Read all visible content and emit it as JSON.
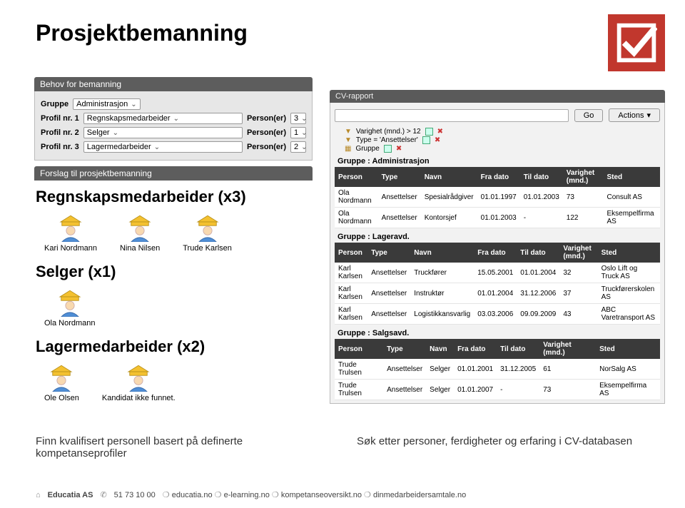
{
  "page_title": "Prosjektbemanning",
  "panel_need": {
    "title": "Behov for bemanning",
    "group_label": "Gruppe",
    "group_value": "Administrasjon",
    "rows": [
      {
        "label": "Profil nr. 1",
        "value": "Regnskapsmedarbeider",
        "persons_label": "Person(er)",
        "count": "3"
      },
      {
        "label": "Profil nr. 2",
        "value": "Selger",
        "persons_label": "Person(er)",
        "count": "1"
      },
      {
        "label": "Profil nr. 3",
        "value": "Lagermedarbeider",
        "persons_label": "Person(er)",
        "count": "2"
      }
    ]
  },
  "panel_suggest": "Forslag til prosjektbemanning",
  "sections": [
    {
      "title": "Regnskapsmedarbeider (x3)",
      "people": [
        {
          "name": "Kari Nordmann"
        },
        {
          "name": "Nina Nilsen"
        },
        {
          "name": "Trude Karlsen"
        }
      ]
    },
    {
      "title": "Selger (x1)",
      "people": [
        {
          "name": "Ola Nordmann"
        }
      ]
    },
    {
      "title": "Lagermedarbeider (x2)",
      "people": [
        {
          "name": "Ole Olsen"
        },
        {
          "name": "Kandidat ikke funnet."
        }
      ]
    }
  ],
  "cv": {
    "title": "CV-rapport",
    "go": "Go",
    "actions": "Actions",
    "filters": [
      {
        "label": "Varighet (mnd.) > 12"
      },
      {
        "label": "Type = 'Ansettelser'"
      },
      {
        "label": "Gruppe"
      }
    ],
    "headers": [
      "Person",
      "Type",
      "Navn",
      "Fra dato",
      "Til dato",
      "Varighet (mnd.)",
      "Sted"
    ],
    "groups": [
      {
        "name": "Gruppe : Administrasjon",
        "rows": [
          [
            "Ola Nordmann",
            "Ansettelser",
            "Spesialrådgiver",
            "01.01.1997",
            "01.01.2003",
            "73",
            "Consult AS"
          ],
          [
            "Ola Nordmann",
            "Ansettelser",
            "Kontorsjef",
            "01.01.2003",
            "-",
            "122",
            "Eksempelfirma AS"
          ]
        ]
      },
      {
        "name": "Gruppe : Lageravd.",
        "rows": [
          [
            "Karl Karlsen",
            "Ansettelser",
            "Truckfører",
            "15.05.2001",
            "01.01.2004",
            "32",
            "Oslo Lift og Truck AS"
          ],
          [
            "Karl Karlsen",
            "Ansettelser",
            "Instruktør",
            "01.01.2004",
            "31.12.2006",
            "37",
            "Truckførerskolen AS"
          ],
          [
            "Karl Karlsen",
            "Ansettelser",
            "Logistikkansvarlig",
            "03.03.2006",
            "09.09.2009",
            "43",
            "ABC Varetransport AS"
          ]
        ]
      },
      {
        "name": "Gruppe : Salgsavd.",
        "rows": [
          [
            "Trude Trulsen",
            "Ansettelser",
            "Selger",
            "01.01.2001",
            "31.12.2005",
            "61",
            "NorSalg AS"
          ],
          [
            "Trude Trulsen",
            "Ansettelser",
            "Selger",
            "01.01.2007",
            "-",
            "73",
            "Eksempelfirma AS"
          ]
        ]
      }
    ]
  },
  "captions": {
    "left": "Finn kvalifisert personell basert på definerte kompetanseprofiler",
    "right": "Søk etter personer, ferdigheter og erfaring i CV-databasen"
  },
  "footer": {
    "company": "Educatia AS",
    "phone": "51 73 10 00",
    "links": [
      "educatia.no",
      "e-learning.no",
      "kompetanseoversikt.no",
      "dinmedarbeidersamtale.no"
    ]
  }
}
